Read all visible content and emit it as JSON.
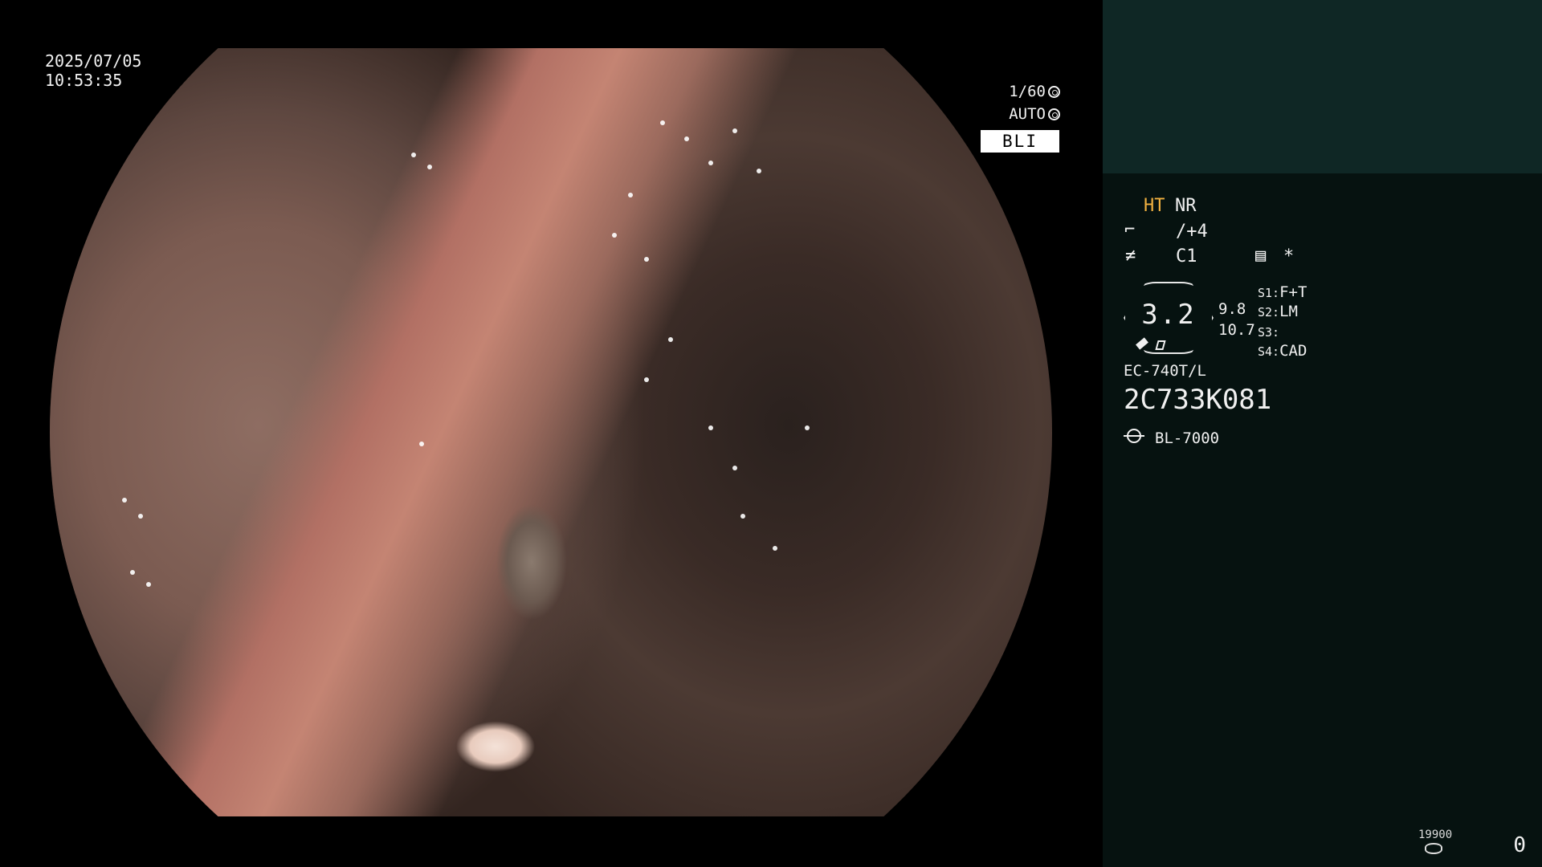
{
  "overlay": {
    "date": "2025/07/05",
    "time": "10:53:35",
    "shutter": "1/60",
    "iris": "AUTO",
    "mode": "BLI"
  },
  "panel": {
    "ht": "HT",
    "nr": "NR",
    "enhance_value": "/+4",
    "color_value": "C1",
    "asterisk": "*",
    "zoom": "3.2",
    "scale_top": "9.8",
    "scale_bottom": "10.7",
    "switches": [
      {
        "key": "S1:",
        "value": "F+T"
      },
      {
        "key": "S2:",
        "value": "LM"
      },
      {
        "key": "S3:",
        "value": ""
      },
      {
        "key": "S4:",
        "value": "CAD"
      }
    ],
    "scope_model": "EC-740T/L",
    "scope_serial": "2C733K081",
    "light_source": "BL-7000",
    "counter_label": "19900",
    "counter_value": "0"
  },
  "colors": {
    "panel_bg": "#061210",
    "panel_top_bg": "#0f2725",
    "ht_color": "#f0b040"
  }
}
